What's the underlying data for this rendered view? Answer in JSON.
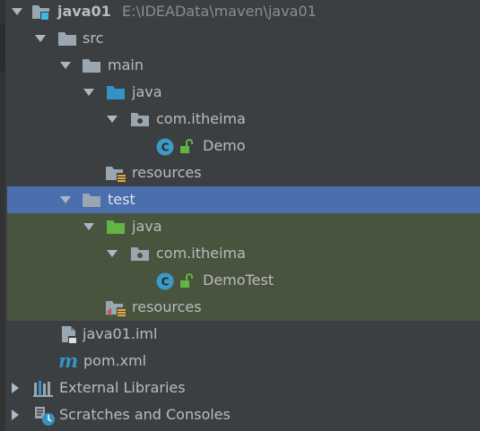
{
  "tree": {
    "root": {
      "name": "java01",
      "path": "E:\\IDEAData\\maven\\java01"
    },
    "src": "src",
    "main": "main",
    "main_java": "java",
    "main_pkg": "com.itheima",
    "demo_class": "Demo",
    "main_resources": "resources",
    "test": "test",
    "test_java": "java",
    "test_pkg": "com.itheima",
    "demotest_class": "DemoTest",
    "test_resources": "resources",
    "iml_file": "java01.iml",
    "pom_file": "pom.xml",
    "external_libraries": "External Libraries",
    "scratches": "Scratches and Consoles"
  },
  "colors": {
    "background": "#3c3f41",
    "selection": "#4b6eaf",
    "test_scope": "#49543f",
    "source_folder": "#3592c4",
    "test_folder": "#62b543",
    "class_icon": "#3a9bc7"
  }
}
